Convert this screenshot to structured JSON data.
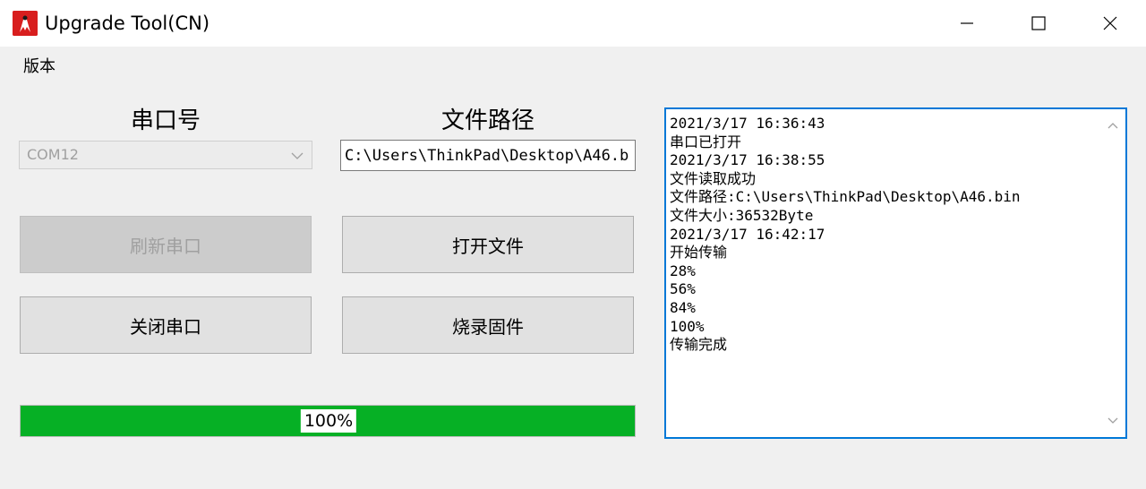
{
  "window": {
    "title": "Upgrade Tool(CN)",
    "app_icon": "app-icon"
  },
  "menu": {
    "items": [
      {
        "label": "版本"
      }
    ]
  },
  "serial": {
    "label": "串口号",
    "selected": "COM12"
  },
  "file": {
    "label": "文件路径",
    "path_value": "C:\\Users\\ThinkPad\\Desktop\\A46.b:"
  },
  "buttons": {
    "refresh": "刷新串口",
    "open_file": "打开文件",
    "close_port": "关闭串口",
    "burn": "烧录固件"
  },
  "progress": {
    "value": 1.0,
    "text": "100%",
    "color": "#06b025"
  },
  "log": {
    "lines": [
      "2021/3/17 16:36:43",
      "串口已打开",
      "2021/3/17 16:38:55",
      "文件读取成功",
      "文件路径:C:\\Users\\ThinkPad\\Desktop\\A46.bin",
      "文件大小:36532Byte",
      "2021/3/17 16:42:17",
      "开始传输",
      "28%",
      "56%",
      "84%",
      "100%",
      "传输完成"
    ]
  },
  "colors": {
    "accent": "#0078d7",
    "progress_fill": "#06b025"
  }
}
